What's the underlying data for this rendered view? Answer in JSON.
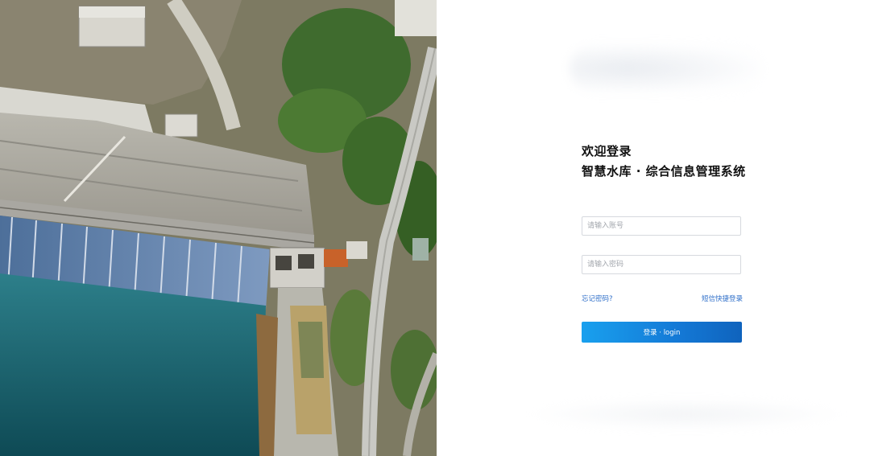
{
  "hero_image": {
    "alt_subject": "aerial-dam-photo"
  },
  "login": {
    "welcome": "欢迎登录",
    "system_name": "智慧水库 · 综合信息管理系统",
    "account_placeholder": "请输入账号",
    "password_placeholder": "请输入密码",
    "forgot_password": "忘记密码?",
    "sms_login": "短信快捷登录",
    "login_button": "登录 · login"
  },
  "colors": {
    "accent": "#1479d6",
    "link": "#2f6fc9",
    "heading": "#111111"
  }
}
